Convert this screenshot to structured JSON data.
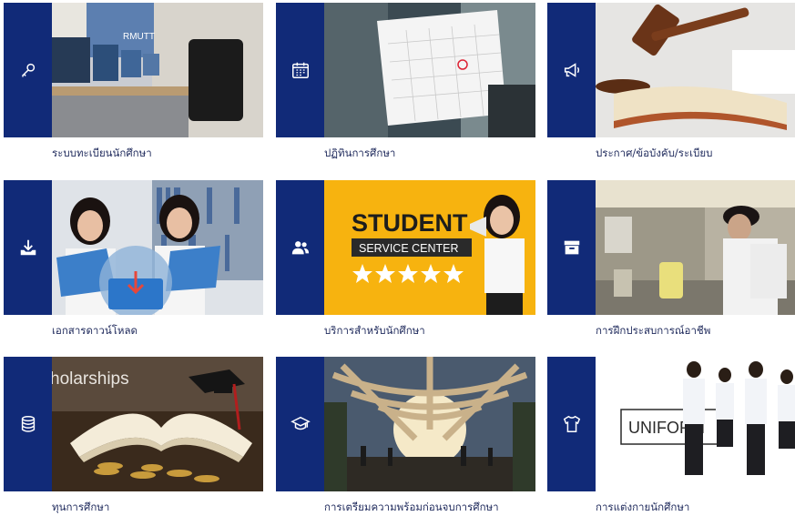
{
  "cards": [
    {
      "label": "ระบบทะเบียนนักศึกษา",
      "icon": "key-icon",
      "photo_text": "RMUTT"
    },
    {
      "label": "ปฏิทินการศึกษา",
      "icon": "calendar-icon",
      "photo_text": ""
    },
    {
      "label": "ประกาศ/ข้อบังคับ/ระเบียบ",
      "icon": "megaphone-icon",
      "photo_text": ""
    },
    {
      "label": "เอกสารดาวน์โหลด",
      "icon": "download-icon",
      "photo_text": ""
    },
    {
      "label": "บริการสำหรับนักศึกษา",
      "icon": "users-icon",
      "photo_text": "STUDENT",
      "photo_subtext": "SERVICE CENTER"
    },
    {
      "label": "การฝึกประสบการณ์อาชีพ",
      "icon": "archive-box-icon",
      "photo_text": ""
    },
    {
      "label": "ทุนการศึกษา",
      "icon": "coin-stack-icon",
      "photo_text": "holarships"
    },
    {
      "label": "การเตรียมความพร้อมก่อนจบการศึกษา",
      "icon": "graduation-cap-icon",
      "photo_text": ""
    },
    {
      "label": "การแต่งกายนักศึกษา",
      "icon": "shirt-icon",
      "photo_text": "UNIFORM"
    }
  ],
  "colors": {
    "accent": "#112a78",
    "label": "#1f2a5c",
    "student_bg": "#f7b30f"
  }
}
